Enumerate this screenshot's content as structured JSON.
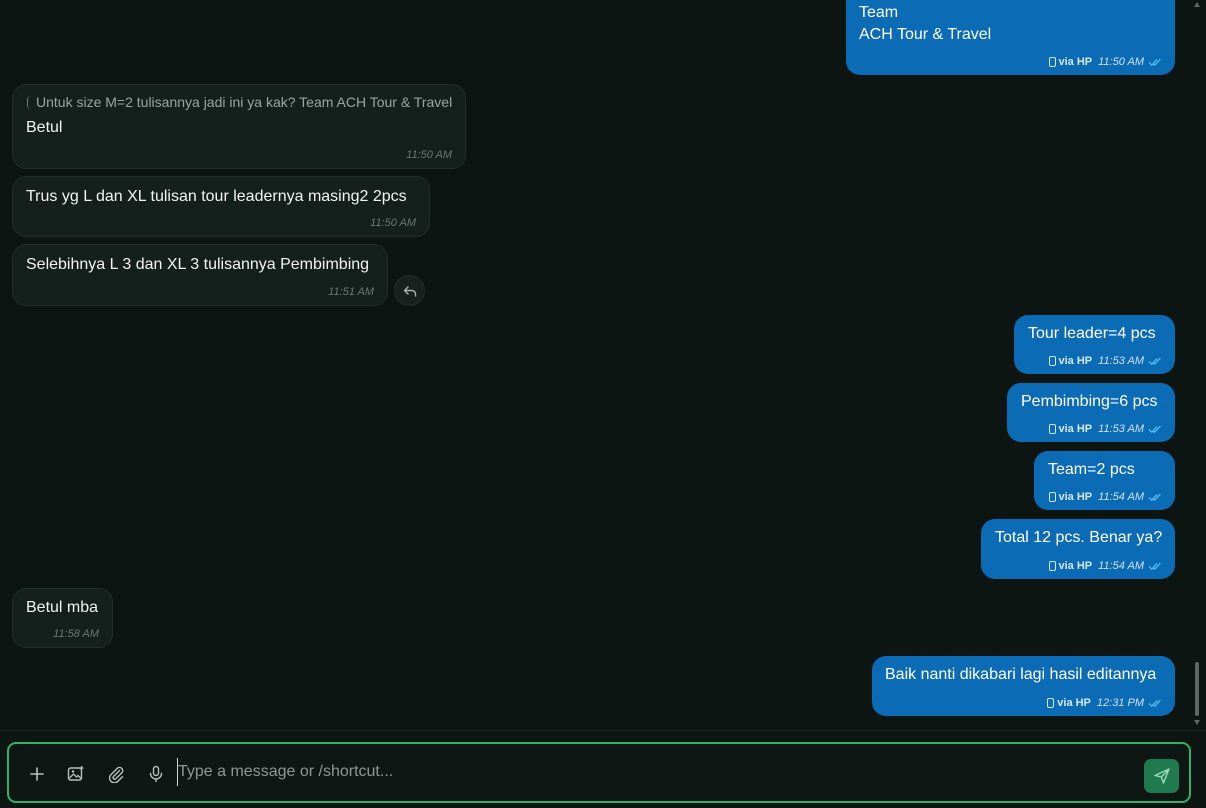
{
  "messages": [
    {
      "id": "m0",
      "dir": "out",
      "text": "        Team\nACH Tour & Travel",
      "via": "via HP",
      "time": "11:50 AM"
    },
    {
      "id": "m1",
      "dir": "in",
      "quote": "Untuk size M=2 tulisannya jadi ini ya kak? Team ACH Tour & Travel",
      "text": "Betul",
      "time": "11:50 AM"
    },
    {
      "id": "m2",
      "dir": "in",
      "text": "Trus yg L dan XL tulisan tour leadernya masing2 2pcs",
      "time": "11:50 AM"
    },
    {
      "id": "m3",
      "dir": "in",
      "text": "Selebihnya L 3 dan XL 3 tulisannya Pembimbing",
      "time": "11:51 AM"
    },
    {
      "id": "m4",
      "dir": "out",
      "text": "Tour leader=4 pcs",
      "via": "via HP",
      "time": "11:53 AM"
    },
    {
      "id": "m5",
      "dir": "out",
      "text": "Pembimbing=6 pcs",
      "via": "via HP",
      "time": "11:53 AM"
    },
    {
      "id": "m6",
      "dir": "out",
      "text": "Team=2 pcs",
      "via": "via HP",
      "time": "11:54 AM"
    },
    {
      "id": "m7",
      "dir": "out",
      "text": "Total 12 pcs. Benar ya?",
      "via": "via HP",
      "time": "11:54 AM"
    },
    {
      "id": "m8",
      "dir": "in",
      "text": "Betul mba",
      "time": "11:58 AM"
    },
    {
      "id": "m9",
      "dir": "out",
      "text": "Baik nanti dikabari lagi hasil editannya",
      "via": "via HP",
      "time": "12:31 PM"
    }
  ],
  "composer": {
    "placeholder": "Type a message or /shortcut...",
    "value": ""
  },
  "icons": {
    "add": "plus-icon",
    "image": "image-add-icon",
    "attach": "paperclip-icon",
    "mic": "microphone-icon",
    "send": "send-icon",
    "reply": "reply-icon",
    "ticks": "double-check-icon",
    "device": "phone-icon"
  },
  "colors": {
    "background": "#0d1512",
    "incoming_bubble": "#151f1c",
    "outgoing_bubble": "#0b6bb5",
    "composer_border": "#2fb36b",
    "send_button": "#1f7a4f",
    "read_ticks": "#53bdeb"
  }
}
